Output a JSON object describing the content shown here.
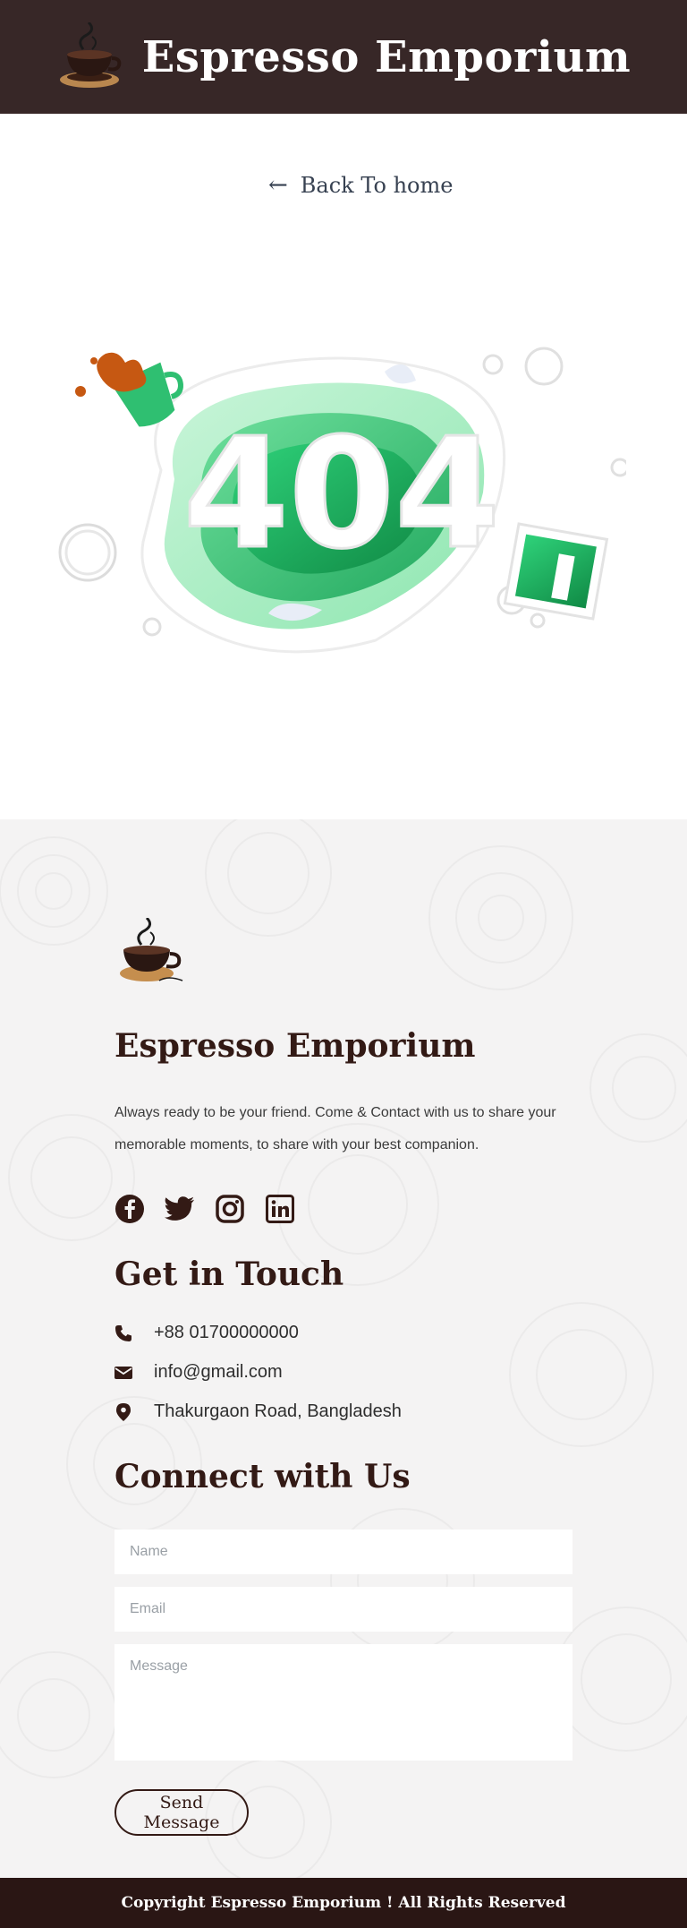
{
  "header": {
    "title": "Espresso Emporium",
    "logo_icon": "coffee-cup-icon"
  },
  "back": {
    "label": "Back To home",
    "icon": "arrow-left-icon"
  },
  "illustration": {
    "error_code": "404",
    "accent_color": "#2fbf71"
  },
  "footer": {
    "title": "Espresso Emporium",
    "about": "Always ready to be your friend. Come & Contact with us to share your memorable moments, to share with your best companion.",
    "socials": [
      {
        "icon": "facebook-icon"
      },
      {
        "icon": "twitter-icon"
      },
      {
        "icon": "instagram-icon"
      },
      {
        "icon": "linkedin-icon"
      }
    ],
    "get_in_touch_title": "Get in Touch",
    "contact": {
      "phone": "+88 01700000000",
      "email": "info@gmail.com",
      "address": "Thakurgaon Road, Bangladesh"
    },
    "connect_title": "Connect with Us",
    "form": {
      "name_placeholder": "Name",
      "email_placeholder": "Email",
      "message_placeholder": "Message",
      "send_label": "Send Message"
    },
    "copyright": "Copyright Espresso Emporium ! All Rights Reserved"
  },
  "colors": {
    "header_bg": "#372727",
    "brand_brown": "#331a15",
    "green": "#2fbf71"
  }
}
